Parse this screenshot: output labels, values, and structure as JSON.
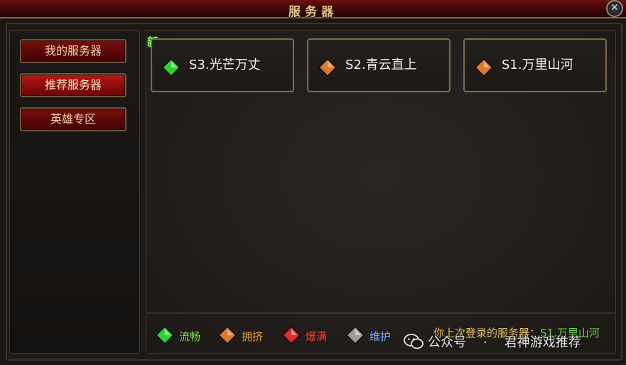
{
  "window": {
    "title": "服务器"
  },
  "sidebar": {
    "items": [
      {
        "label": "我的服务器",
        "active": false
      },
      {
        "label": "推荐服务器",
        "active": true
      },
      {
        "label": "英雄专区",
        "active": false
      }
    ]
  },
  "server_list": {
    "new_tag": "新",
    "servers": [
      {
        "name": "S3.光芒万丈",
        "status": "流畅",
        "gem_color": "#2fd12f"
      },
      {
        "name": "S2.青云直上",
        "status": "拥挤",
        "gem_color": "#e0782a"
      },
      {
        "name": "S1.万里山河",
        "status": "拥挤",
        "gem_color": "#e0782a"
      }
    ]
  },
  "legend": [
    {
      "label": "流畅",
      "color": "#6fe04a",
      "gem_color": "#2fd12f"
    },
    {
      "label": "拥挤",
      "color": "#e59a3a",
      "gem_color": "#e0782a"
    },
    {
      "label": "爆满",
      "color": "#ff3b2f",
      "gem_color": "#e02a2a"
    },
    {
      "label": "维护",
      "color": "#7aa8ff",
      "gem_color": "#9a9a9a"
    }
  ],
  "last_login": {
    "prefix": "你上次登录的服务器：",
    "server": "S1.万里山河"
  },
  "watermark": {
    "account_label": "公众号",
    "account_name": "君神游戏推荐"
  }
}
